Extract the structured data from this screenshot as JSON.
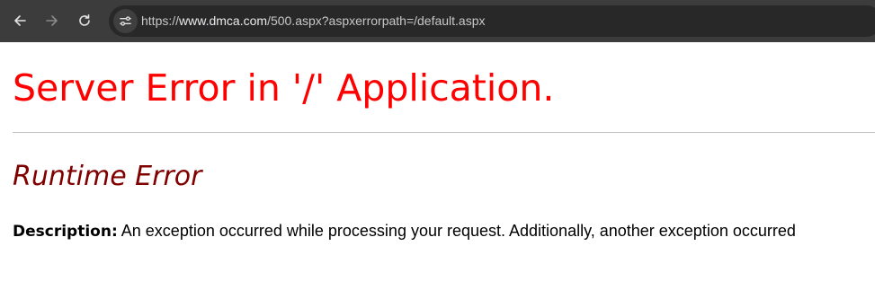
{
  "browser": {
    "url_prefix": "https://",
    "url_host": "www.dmca.com",
    "url_path": "/500.aspx?aspxerrorpath=/default.aspx",
    "icons": {
      "back": "arrow-left-icon",
      "forward": "arrow-right-icon",
      "reload": "reload-icon",
      "site_info": "tune-icon"
    }
  },
  "page": {
    "heading": "Server Error in '/' Application.",
    "subheading": "Runtime Error",
    "description_label": "Description:",
    "description_text": "An exception occurred while processing your request. Additionally, another exception occurred"
  },
  "colors": {
    "heading": "#ff0000",
    "subheading": "#800000"
  }
}
